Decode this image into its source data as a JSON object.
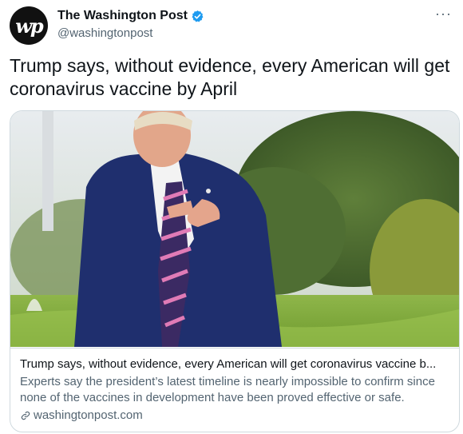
{
  "account": {
    "name": "The Washington Post",
    "handle": "@washingtonpost",
    "avatar_text": "wp",
    "verified_icon": "verified-badge-icon",
    "verified_color": "#1d9bf0"
  },
  "more_icon": "···",
  "tweet_text": "Trump says, without evidence, every American will get coronavirus vaccine by April",
  "card": {
    "title": "Trump says, without evidence, every American will get coronavirus vaccine b...",
    "description": "Experts say the president’s latest timeline is nearly impossible to confirm since none of the vaccines in development have been proved effective or safe.",
    "domain": "washingtonpost.com",
    "link_icon": "link-icon"
  },
  "colors": {
    "text": "#0f1419",
    "secondary": "#536471",
    "border": "#cfd9de"
  }
}
